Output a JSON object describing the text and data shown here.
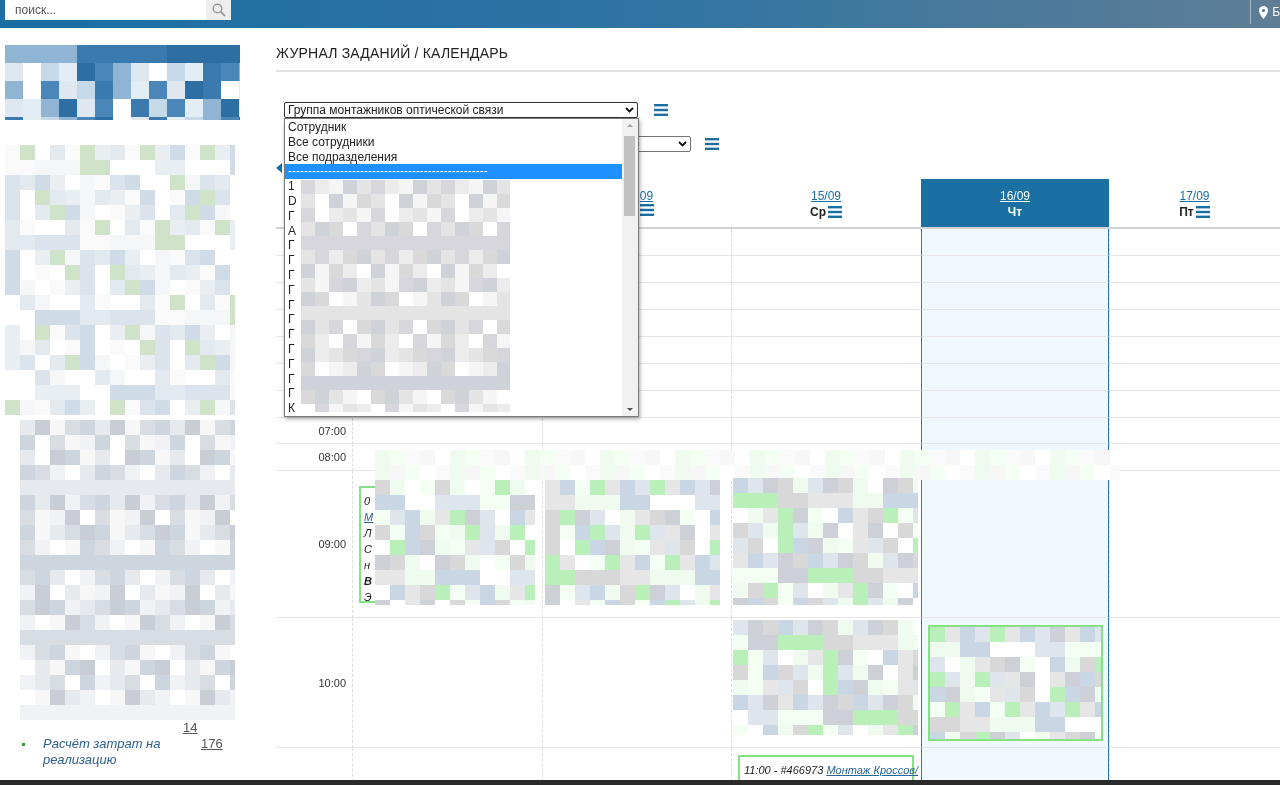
{
  "top_bar": {
    "search": {
      "placeholder": "поиск..."
    },
    "location": "Б"
  },
  "sidebar": {
    "items": [
      {
        "count": "14"
      },
      {
        "label": "Расчёт затрат на реализацию",
        "count": "176"
      }
    ]
  },
  "page_title": "ЖУРНАЛ ЗАДАНИЙ / КАЛЕНДАРЬ",
  "filters": [
    {
      "kind": "select",
      "value": "Группа монтажников оптической связи",
      "expanded": true
    },
    {
      "kind": "select"
    }
  ],
  "dropdown": {
    "options": [
      {
        "label": "Сотрудник",
        "selected": false
      },
      {
        "label": "Все сотрудники",
        "selected": false
      },
      {
        "label": "Все подразделения",
        "selected": false
      },
      {
        "label": "--------------------------------------------------",
        "selected": true
      },
      {
        "label": "1",
        "selected": false
      },
      {
        "label": "D",
        "selected": false
      },
      {
        "label": "Г",
        "selected": false
      },
      {
        "label": "А",
        "selected": false
      },
      {
        "label": "Г",
        "selected": false
      },
      {
        "label": "Г",
        "selected": false
      },
      {
        "label": "Г",
        "selected": false
      },
      {
        "label": "Г",
        "selected": false
      },
      {
        "label": "Г",
        "selected": false
      },
      {
        "label": "Г",
        "selected": false
      },
      {
        "label": "Г",
        "selected": false
      },
      {
        "label": "Г",
        "selected": false
      },
      {
        "label": "Г",
        "selected": false
      },
      {
        "label": "Г",
        "selected": false
      },
      {
        "label": "Г",
        "selected": false
      },
      {
        "label": "К",
        "selected": false
      }
    ]
  },
  "calendar": {
    "days": [
      {
        "selected": false
      },
      {
        "date": "09",
        "cut": true,
        "menu": true,
        "selected": false
      },
      {
        "date": "15/09",
        "weekday": "Ср",
        "menu": true,
        "selected": false
      },
      {
        "date": "16/09",
        "weekday": "Чт",
        "menu": false,
        "selected": true
      },
      {
        "date": "17/09",
        "weekday": "Пт",
        "menu": true,
        "selected": false
      }
    ],
    "rows": [
      {
        "time": "07:00"
      },
      {
        "time": "08:00"
      },
      {
        "time": "09:00",
        "cells": {
          "column_1": {
            "kind": "clipped",
            "lines": [
              [
                {
                  "text": "0",
                  "kind": "text"
                }
              ],
              [
                {
                  "text": "М",
                  "kind": "link"
                }
              ],
              [
                {
                  "text": "Л",
                  "kind": "text"
                }
              ],
              [
                {
                  "text": "С",
                  "kind": "text"
                }
              ],
              [
                {
                  "text": "н",
                  "kind": "text"
                }
              ],
              [
                {
                  "text": "В",
                  "kind": "bold"
                }
              ],
              [
                {
                  "text": "Э",
                  "kind": "text"
                }
              ]
            ]
          }
        }
      },
      {
        "time": "10:00"
      },
      {
        "cells": {
          "column_3": {
            "kind": "full",
            "lines": [
              [
                {
                  "text": "11:00 - #466973",
                  "kind": "text"
                },
                {
                  "text": "Монтаж Кроссов/",
                  "kind": "link"
                }
              ]
            ]
          }
        }
      }
    ]
  }
}
